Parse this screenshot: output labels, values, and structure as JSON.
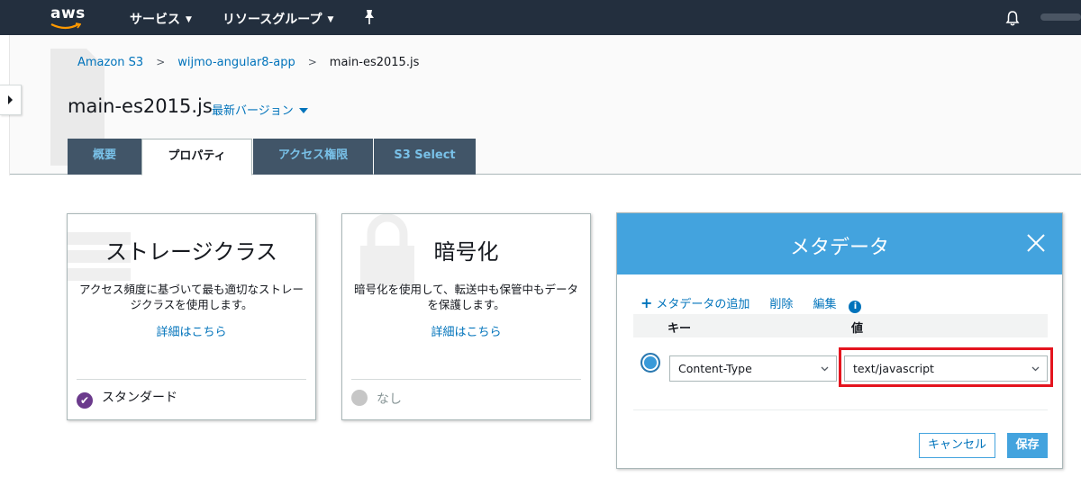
{
  "topnav": {
    "logo_text": "aws",
    "services": "サービス",
    "resource_groups": "リソースグループ"
  },
  "breadcrumb": {
    "items": [
      "Amazon S3",
      "wijmo-angular8-app"
    ],
    "current": "main-es2015.js"
  },
  "page": {
    "title": "main-es2015.js",
    "version": "最新バージョン"
  },
  "tabs": [
    "概要",
    "プロパティ",
    "アクセス権限",
    "S3 Select"
  ],
  "cards": {
    "storage": {
      "title": "ストレージクラス",
      "desc": "アクセス頻度に基づいて最も適切なストレージクラスを使用します。",
      "link": "詳細はこちら",
      "status": "スタンダード"
    },
    "encryption": {
      "title": "暗号化",
      "desc": "暗号化を使用して、転送中も保管中もデータを保護します。",
      "link": "詳細はこちら",
      "status": "なし"
    }
  },
  "metadata": {
    "title": "メタデータ",
    "add": "メタデータの追加",
    "delete": "削除",
    "edit": "編集",
    "col_key": "キー",
    "col_value": "値",
    "row": {
      "key": "Content-Type",
      "value": "text/javascript"
    },
    "cancel": "キャンセル",
    "save": "保存"
  },
  "colors": {
    "nav_bg": "#232f3e",
    "tab_dark": "#415568",
    "accent_blue": "#43a3de",
    "link_blue": "#0073bb",
    "highlight_red": "#e4141e",
    "check_purple": "#6b3a8c"
  },
  "icons": [
    "pin-icon",
    "bell-icon",
    "close-icon",
    "chevron-down-icon",
    "info-icon",
    "check-icon"
  ]
}
